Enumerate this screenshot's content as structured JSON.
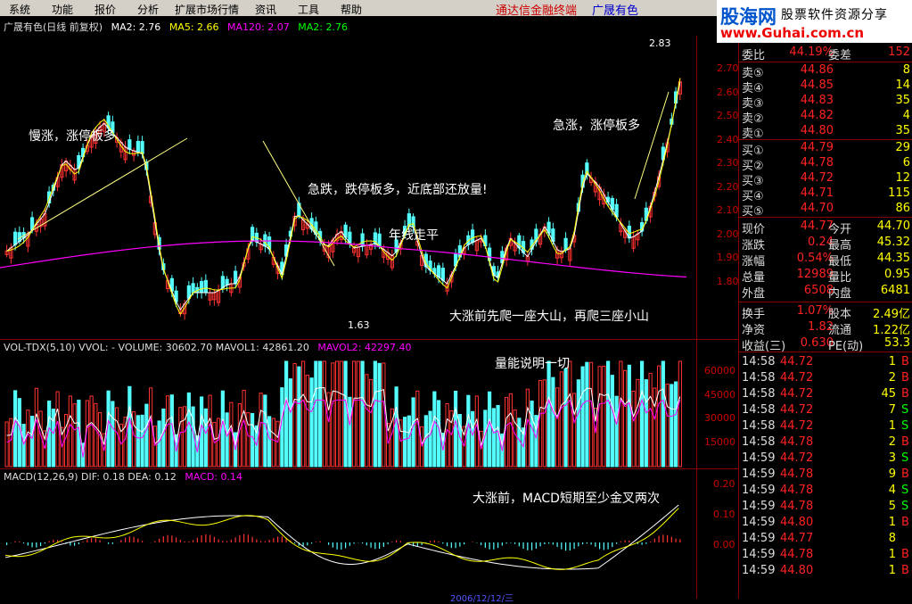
{
  "menu": [
    "系统",
    "功能",
    "报价",
    "分析",
    "扩展市场行情",
    "资讯",
    "工具",
    "帮助"
  ],
  "header": {
    "terminal_title": "通达信金融终端",
    "stock_name": "广晟有色"
  },
  "logo": {
    "brand": "股海网",
    "slogan": "股票软件资源分享",
    "url": "www.Guhai.com.cn"
  },
  "main_chart": {
    "title": "广晟有色(日线 前复权)",
    "ma": [
      {
        "label": "MA2: 2.76",
        "color": "#ffffff"
      },
      {
        "label": "MA5: 2.66",
        "color": "#ffff00"
      },
      {
        "label": "MA120: 2.07",
        "color": "#ff00ff"
      },
      {
        "label": "MA2: 2.76",
        "color": "#00ff00"
      }
    ],
    "high_label": "2.83",
    "low_label": "1.63",
    "y_ticks": [
      "2.70",
      "2.60",
      "2.50",
      "2.40",
      "2.30",
      "2.20",
      "2.10",
      "2.00",
      "1.90",
      "1.80"
    ],
    "annotations": {
      "slow_rise": "慢涨，涨停板多",
      "sharp_drop": "急跌，跌停板多，近底部还放量!",
      "year_line": "年线走平",
      "fast_rise": "急涨，涨停板多",
      "mountains": "大涨前先爬一座大山，再爬三座小山"
    }
  },
  "volume_chart": {
    "title": "VOL-TDX(5,10)  VVOL: -  VOLUME: 30602.70  MAVOL1: 42861.20",
    "mavol2": "MAVOL2: 42297.40",
    "y_ticks": [
      "60000",
      "45000",
      "30000",
      "15000"
    ],
    "annotation": "量能说明一切"
  },
  "macd_chart": {
    "title": "MACD(12,26,9)  DIF: 0.18  DEA: 0.12",
    "macd_value": "MACD: 0.14",
    "y_ticks": [
      "0.20",
      "0.10",
      "0.00"
    ],
    "annotation": "大涨前，MACD短期至少金叉两次"
  },
  "bottom_partial": {
    "date": "2006/12/12/三"
  },
  "sidebar": {
    "top": {
      "label": "委比",
      "value": "44.19%",
      "label2": "委差",
      "value2": "152"
    },
    "sell": [
      {
        "label": "卖⑤",
        "price": "44.86",
        "vol": "8"
      },
      {
        "label": "卖④",
        "price": "44.85",
        "vol": "14"
      },
      {
        "label": "卖③",
        "price": "44.83",
        "vol": "35"
      },
      {
        "label": "卖②",
        "price": "44.82",
        "vol": "4"
      },
      {
        "label": "卖①",
        "price": "44.80",
        "vol": "35"
      }
    ],
    "buy": [
      {
        "label": "买①",
        "price": "44.79",
        "vol": "29"
      },
      {
        "label": "买②",
        "price": "44.78",
        "vol": "6"
      },
      {
        "label": "买③",
        "price": "44.72",
        "vol": "12"
      },
      {
        "label": "买④",
        "price": "44.71",
        "vol": "115"
      },
      {
        "label": "买⑤",
        "price": "44.70",
        "vol": "86"
      }
    ],
    "stats": [
      {
        "l1": "现价",
        "v1": "44.77",
        "l2": "今开",
        "v2": "44.70"
      },
      {
        "l1": "涨跌",
        "v1": "0.24",
        "l2": "最高",
        "v2": "45.32"
      },
      {
        "l1": "涨幅",
        "v1": "0.54%",
        "l2": "最低",
        "v2": "44.35"
      },
      {
        "l1": "总量",
        "v1": "12989",
        "l2": "量比",
        "v2": "0.95"
      },
      {
        "l1": "外盘",
        "v1": "6508",
        "l2": "内盘",
        "v2": "6481"
      }
    ],
    "stats2": [
      {
        "l1": "换手",
        "v1": "1.07%",
        "l2": "股本",
        "v2": "2.49亿"
      },
      {
        "l1": "净资",
        "v1": "1.82",
        "l2": "流通",
        "v2": "1.22亿"
      },
      {
        "l1": "收益(三)",
        "v1": "0.630",
        "l2": "PE(动)",
        "v2": "53.3"
      }
    ],
    "ticks": [
      {
        "t": "14:58",
        "p": "44.72",
        "q": "1",
        "d": "B"
      },
      {
        "t": "14:58",
        "p": "44.72",
        "q": "2",
        "d": "B"
      },
      {
        "t": "14:58",
        "p": "44.72",
        "q": "45",
        "d": "B"
      },
      {
        "t": "14:58",
        "p": "44.72",
        "q": "7",
        "d": "S"
      },
      {
        "t": "14:58",
        "p": "44.72",
        "q": "1",
        "d": "S"
      },
      {
        "t": "14:58",
        "p": "44.78",
        "q": "2",
        "d": "B"
      },
      {
        "t": "14:59",
        "p": "44.72",
        "q": "3",
        "d": "S"
      },
      {
        "t": "14:59",
        "p": "44.78",
        "q": "9",
        "d": "B"
      },
      {
        "t": "14:59",
        "p": "44.78",
        "q": "4",
        "d": "S"
      },
      {
        "t": "14:59",
        "p": "44.78",
        "q": "5",
        "d": "S"
      },
      {
        "t": "14:59",
        "p": "44.80",
        "q": "1",
        "d": "B"
      },
      {
        "t": "14:59",
        "p": "44.77",
        "q": "8",
        "d": ""
      },
      {
        "t": "14:59",
        "p": "44.78",
        "q": "1",
        "d": "B"
      },
      {
        "t": "14:59",
        "p": "44.80",
        "q": "1",
        "d": "B"
      }
    ]
  }
}
